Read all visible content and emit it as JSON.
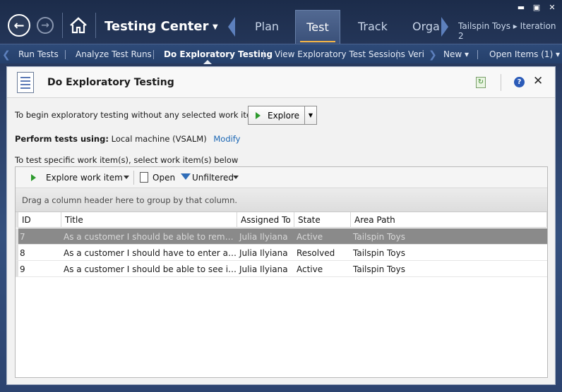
{
  "window": {
    "controls": [
      "▬",
      "▣",
      "✕"
    ]
  },
  "nav": {
    "app_title": "Testing Center",
    "tabs": [
      "Plan",
      "Test",
      "Track",
      "Orga"
    ],
    "active_tab": "Test",
    "project": "Tailspin Toys ▸ Iteration 2"
  },
  "subnav": {
    "items": [
      "Run Tests",
      "Analyze Test Runs",
      "Do Exploratory Testing",
      "View Exploratory Test Sessions",
      "Verif"
    ],
    "new_label": "New ▾",
    "open_items_label": "Open Items (1) ▾"
  },
  "panel": {
    "title": "Do Exploratory Testing",
    "intro": "To begin exploratory testing without any selected work items:",
    "explore_button": "Explore",
    "perform_label": "Perform tests using:",
    "perform_value": "Local machine (VSALM)",
    "modify_link": "Modify",
    "specific_text": "To test specific work item(s), select work item(s) below"
  },
  "toolbar": {
    "explore_item": "Explore work item",
    "open": "Open",
    "filter": "Unfiltered"
  },
  "grid": {
    "group_hint": "Drag a column header here to group by that column.",
    "columns": [
      "ID",
      "Title",
      "Assigned To",
      "State",
      "Area Path"
    ],
    "rows": [
      {
        "id": "7",
        "title": "As a customer I should be able to remove ite...",
        "assigned": "Julia Ilyiana",
        "state": "Active",
        "area": "Tailspin Toys"
      },
      {
        "id": "8",
        "title": "As a customer I should have to enter a stron...",
        "assigned": "Julia Ilyiana",
        "state": "Resolved",
        "area": "Tailspin Toys"
      },
      {
        "id": "9",
        "title": "As a customer I should be able to see images...",
        "assigned": "Julia Ilyiana",
        "state": "Active",
        "area": "Tailspin Toys"
      }
    ]
  }
}
